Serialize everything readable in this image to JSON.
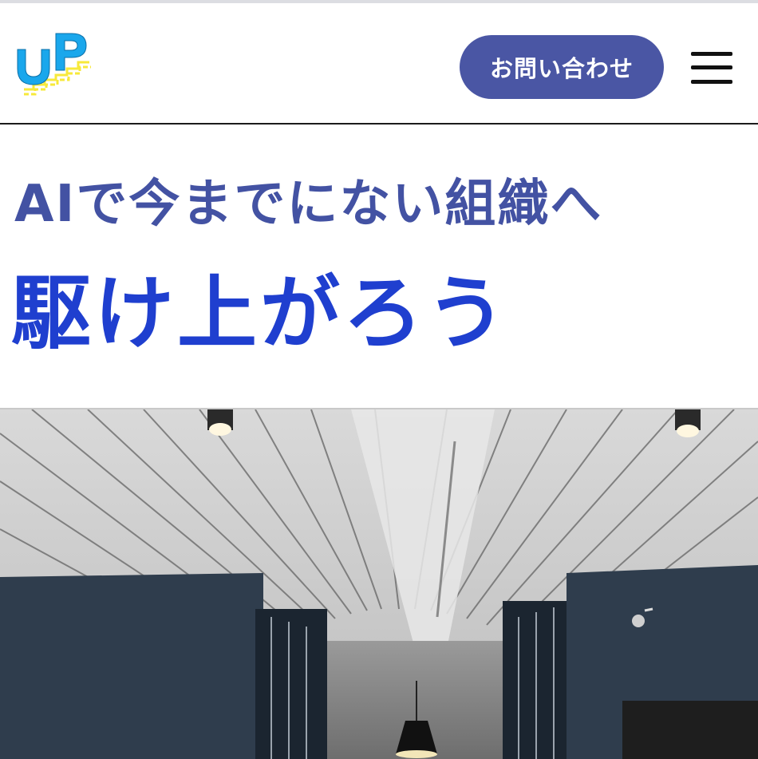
{
  "header": {
    "logo_text": "UP",
    "contact_label": "お問い合わせ",
    "menu_icon": "hamburger-menu-icon"
  },
  "hero": {
    "tagline": "AIで今までにない組織へ",
    "headline": "駆け上がろう"
  },
  "photo": {
    "subject": "office-corridor-ceiling"
  },
  "colors": {
    "button_bg": "#4a56a4",
    "tagline": "#4352a3",
    "headline": "#1f3fcf",
    "logo_blue": "#1aa7ec",
    "logo_yellow": "#f7e93a"
  }
}
